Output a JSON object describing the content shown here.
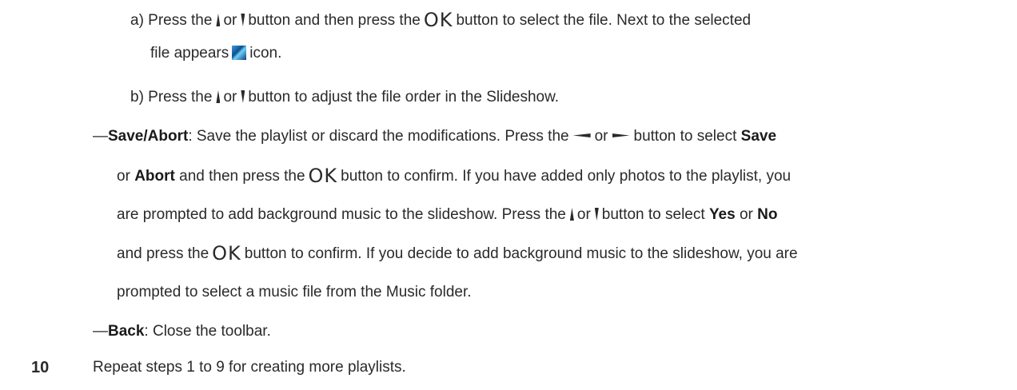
{
  "buttons": {
    "ok": "OK"
  },
  "icons": [
    "up-button-icon",
    "down-button-icon",
    "left-button-icon",
    "right-button-icon",
    "selected-file-icon"
  ],
  "items": {
    "a": {
      "l1_p1": "a) Press the",
      "l1_p2": "or",
      "l1_p3": "button and then press the",
      "l1_p4": "button to select the file. Next to the selected",
      "l2_p1": "file appears",
      "l2_p2": "icon."
    },
    "b": {
      "p1": "b) Press the",
      "p2": "or",
      "p3": "button to adjust the file order in the Slideshow."
    },
    "save_abort": {
      "dash": "—",
      "term": "Save/Abort",
      "l1_p1": ": Save the playlist or discard the modifications. Press the",
      "l1_p2": "or",
      "l1_p3": "button to select",
      "save": "Save",
      "l2_p1": "or",
      "abort": "Abort",
      "l2_p2": "and then press the",
      "l2_p3": "button to confirm. If you have added only photos to the playlist, you",
      "l3_p1": "are prompted to add background music to the slideshow. Press the",
      "l3_p2": "or",
      "l3_p3": "button to select",
      "yes": "Yes",
      "l3_p4": "or",
      "no": "No",
      "l4_p1": "and press the",
      "l4_p2": "button to confirm. If you decide to add background music to the slideshow, you are",
      "l5": "prompted to select a music file from the Music folder."
    },
    "back": {
      "dash": "—",
      "term": "Back",
      "text": ": Close the toolbar."
    }
  },
  "step10": {
    "number": "10",
    "text": "Repeat steps 1 to 9 for creating more playlists."
  }
}
